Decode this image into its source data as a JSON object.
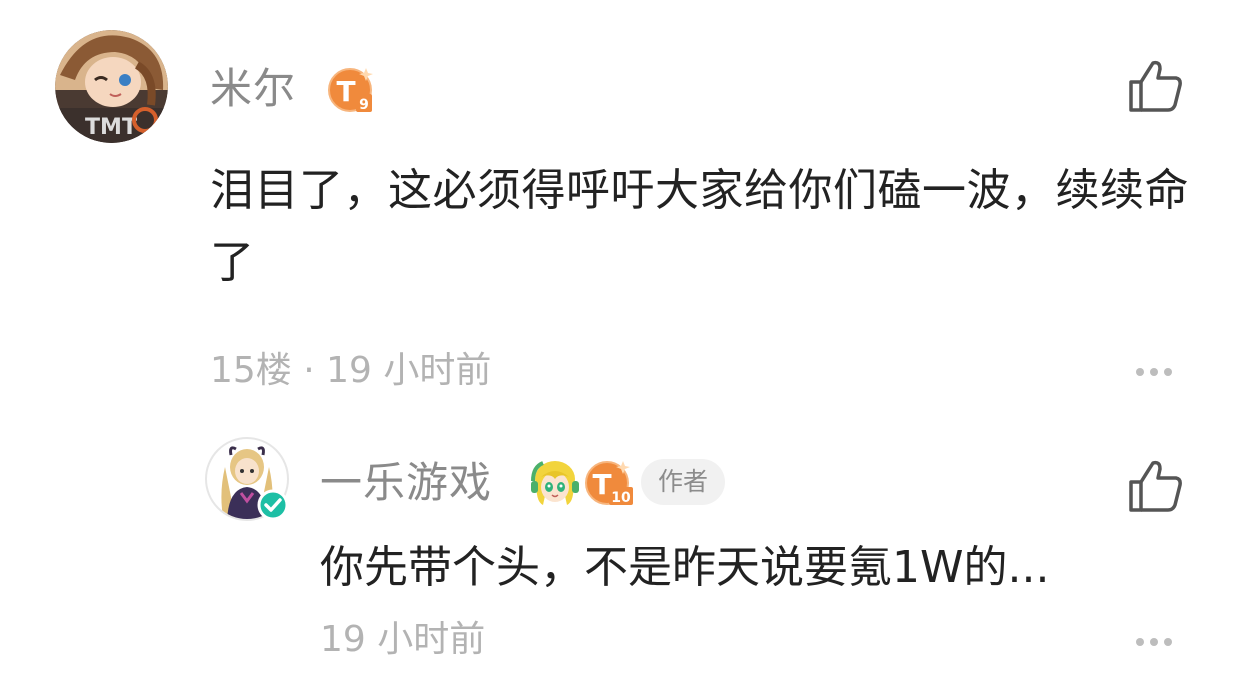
{
  "comment": {
    "username": "米尔",
    "level_badge": {
      "letter": "T",
      "level": "9",
      "color": "#f08a3c"
    },
    "text": "泪目了，这必须得呼吁大家给你们磕一波，续续命了",
    "meta": "15楼 · 19 小时前",
    "avatar_icon": "game-character-avatar",
    "like_icon": "thumbs-up-icon",
    "more_icon": "more-dots-icon"
  },
  "reply": {
    "username": "一乐游戏",
    "level_badge": {
      "letter": "T",
      "level": "10",
      "color": "#f08a3c"
    },
    "mascot_icon": "mascot-badge-icon",
    "author_tag": "作者",
    "text": "你先带个头，不是昨天说要氪1W的...",
    "meta": "19 小时前",
    "avatar_icon": "anime-girl-avatar",
    "verified_icon": "verified-check-icon",
    "like_icon": "thumbs-up-icon",
    "more_icon": "more-dots-icon"
  },
  "colors": {
    "username": "#8a8a8a",
    "body_text": "#222222",
    "meta_text": "#b3b3b3",
    "badge_orange": "#f08a3c",
    "verified_teal": "#1dbfa5",
    "tag_bg": "#f1f1f1"
  }
}
